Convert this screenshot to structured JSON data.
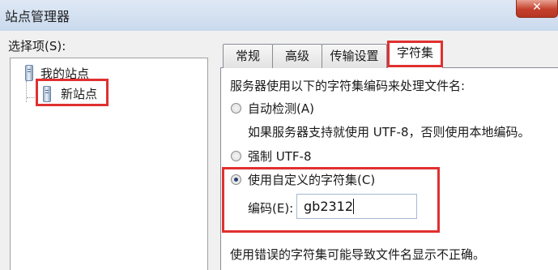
{
  "window": {
    "title": "站点管理器",
    "close_symbol": "✕"
  },
  "left_panel": {
    "label": "选择项(S):",
    "tree": {
      "root": {
        "label": "我的站点",
        "icon": "server-icon"
      },
      "child": {
        "label": "新站点",
        "icon": "server-icon",
        "selected": true
      }
    }
  },
  "tabs": [
    {
      "label": "常规"
    },
    {
      "label": "高级"
    },
    {
      "label": "传输设置"
    },
    {
      "label": "字符集",
      "active": true
    }
  ],
  "charset": {
    "intro": "服务器使用以下的字符集编码来处理文件名:",
    "auto_detect": {
      "label": "自动检测(A)",
      "description": "如果服务器支持就使用 UTF-8，否则使用本地编码。",
      "checked": false
    },
    "force_utf8": {
      "label": "强制 UTF-8",
      "checked": false
    },
    "custom": {
      "label": "使用自定义的字符集(C)",
      "checked": true
    },
    "encoding_label": "编码(E):",
    "encoding_value": "gb2312",
    "warning": "使用错误的字符集可能导致文件名显示不正确。"
  },
  "colors": {
    "highlight": "#e03030",
    "titlebar": "#c9d9ed",
    "close": "#c4402c"
  }
}
